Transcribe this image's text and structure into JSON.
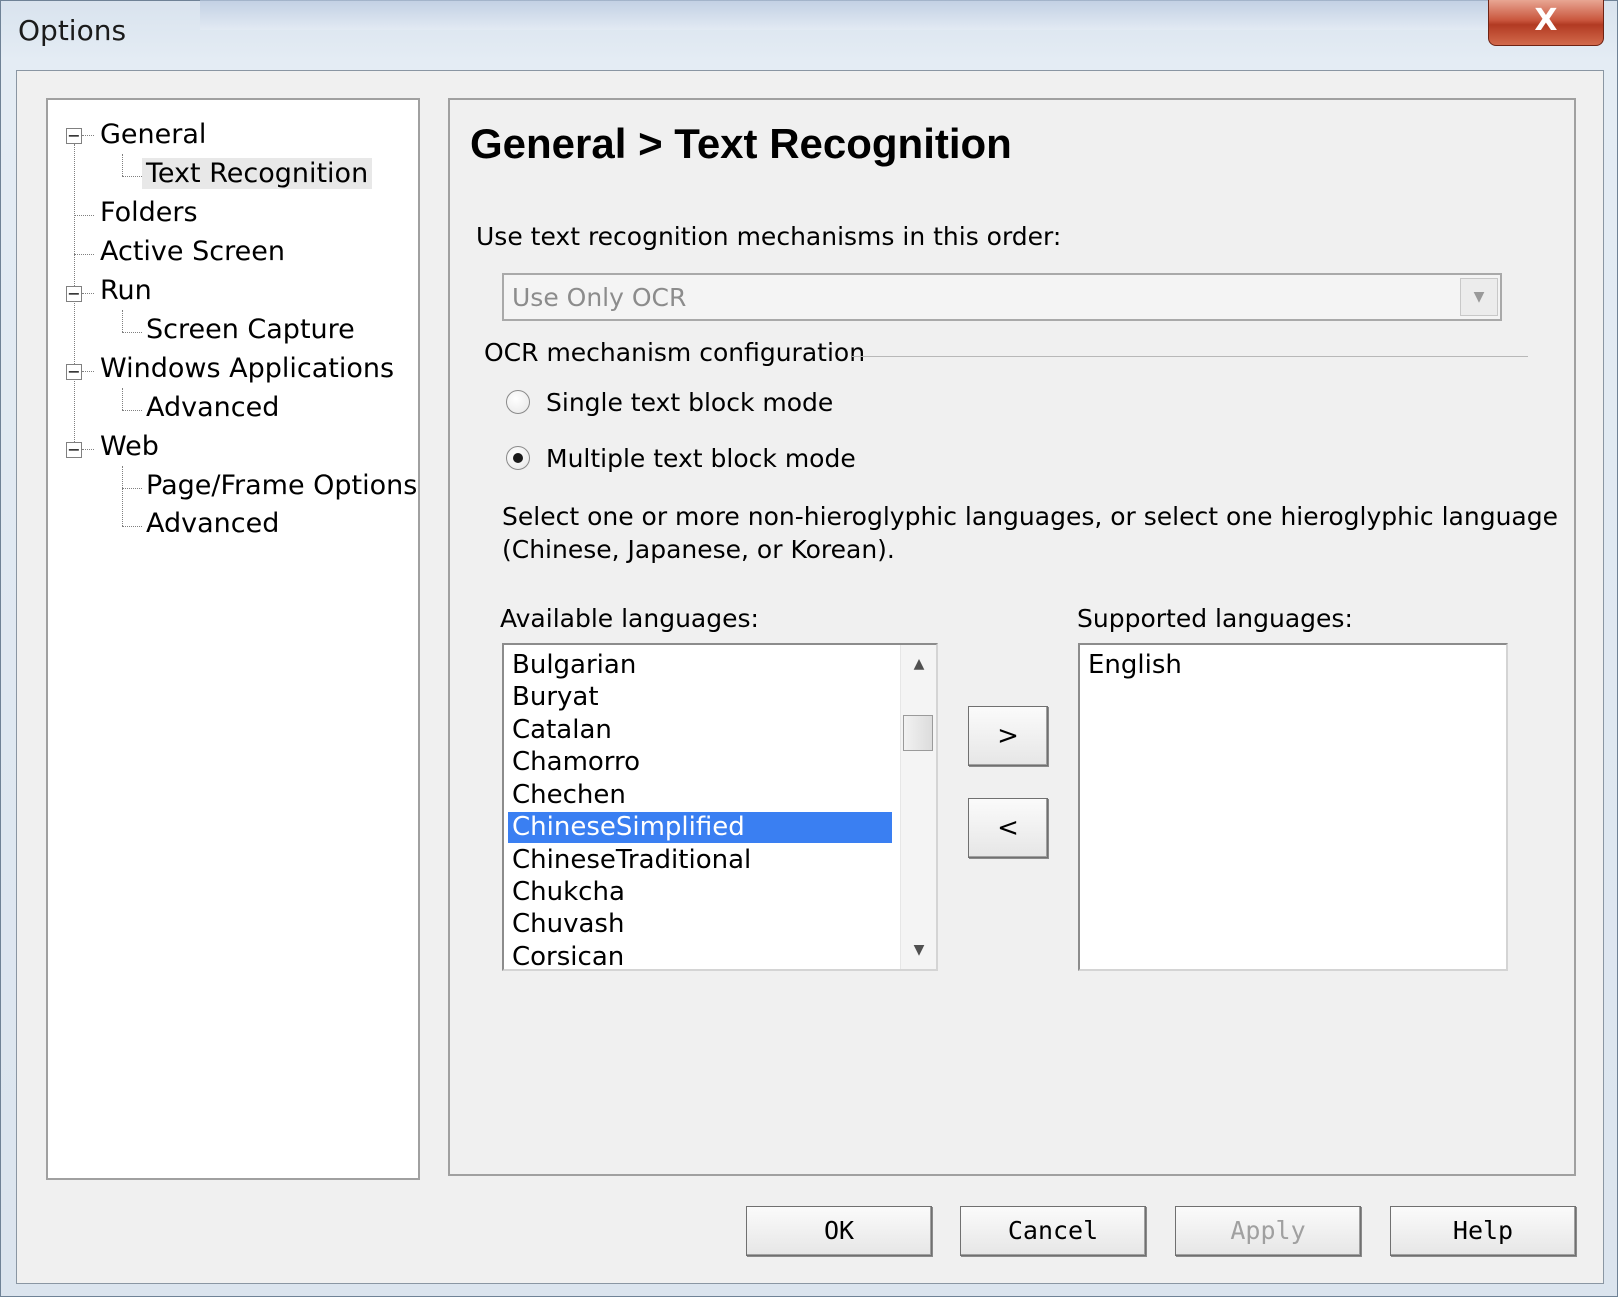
{
  "window": {
    "title": "Options",
    "close_glyph": "X"
  },
  "tree": {
    "items": [
      {
        "label": "General",
        "expander": "−"
      },
      {
        "label": "Text Recognition"
      },
      {
        "label": "Folders"
      },
      {
        "label": "Active Screen"
      },
      {
        "label": "Run",
        "expander": "−"
      },
      {
        "label": "Screen Capture"
      },
      {
        "label": "Windows Applications",
        "expander": "−"
      },
      {
        "label": "Advanced"
      },
      {
        "label": "Web",
        "expander": "−"
      },
      {
        "label": "Page/Frame Options"
      },
      {
        "label": "Advanced"
      }
    ]
  },
  "content": {
    "title": "General > Text Recognition",
    "order_label": "Use text recognition mechanisms in this order:",
    "order_combo": {
      "value": "Use Only OCR",
      "arrow": "▼"
    },
    "ocr_group_label": "OCR mechanism configuration",
    "radio_single": {
      "label": "Single text block mode",
      "checked": false
    },
    "radio_multiple": {
      "label": "Multiple text block mode",
      "checked": true
    },
    "instructions_line1": "Select one or more non-hieroglyphic languages, or select one hieroglyphic language",
    "instructions_line2": "(Chinese, Japanese, or Korean).",
    "available_label": "Available languages:",
    "available": [
      "Bulgarian",
      "Buryat",
      "Catalan",
      "Chamorro",
      "Chechen",
      "ChineseSimplified",
      "ChineseTraditional",
      "Chukcha",
      "Chuvash",
      "Corsican"
    ],
    "available_selected": "ChineseSimplified",
    "supported_label": "Supported languages:",
    "supported": [
      "English"
    ],
    "add_button": ">",
    "remove_button": "<",
    "scroll_up": "▲",
    "scroll_down": "▼"
  },
  "footer": {
    "ok": "OK",
    "cancel": "Cancel",
    "apply": "Apply",
    "help": "Help"
  }
}
